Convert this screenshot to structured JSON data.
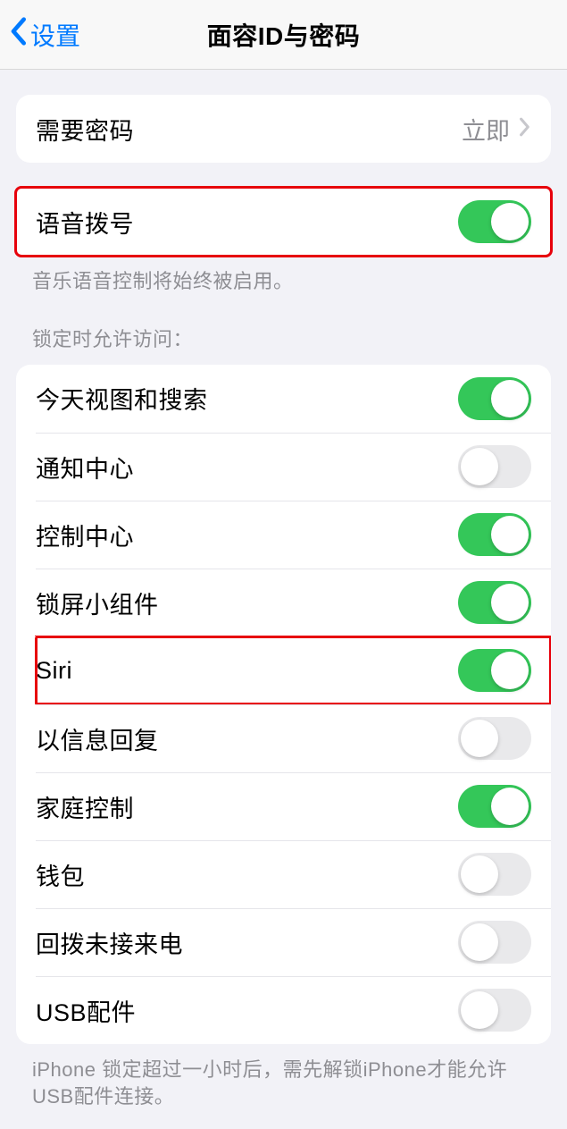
{
  "nav": {
    "back_label": "设置",
    "title": "面容ID与密码"
  },
  "group1": {
    "require_passcode_label": "需要密码",
    "require_passcode_value": "立即"
  },
  "group2": {
    "voice_dial_label": "语音拨号",
    "voice_dial_on": true,
    "footer": "音乐语音控制将始终被启用。"
  },
  "group3": {
    "header": "锁定时允许访问：",
    "items": [
      {
        "label": "今天视图和搜索",
        "on": true,
        "highlight": false
      },
      {
        "label": "通知中心",
        "on": false,
        "highlight": false
      },
      {
        "label": "控制中心",
        "on": true,
        "highlight": false
      },
      {
        "label": "锁屏小组件",
        "on": true,
        "highlight": false
      },
      {
        "label": "Siri",
        "on": true,
        "highlight": true
      },
      {
        "label": "以信息回复",
        "on": false,
        "highlight": false
      },
      {
        "label": "家庭控制",
        "on": true,
        "highlight": false
      },
      {
        "label": "钱包",
        "on": false,
        "highlight": false
      },
      {
        "label": "回拨未接来电",
        "on": false,
        "highlight": false
      },
      {
        "label": "USB配件",
        "on": false,
        "highlight": false
      }
    ],
    "footer": "iPhone 锁定超过一小时后，需先解锁iPhone才能允许USB配件连接。"
  }
}
